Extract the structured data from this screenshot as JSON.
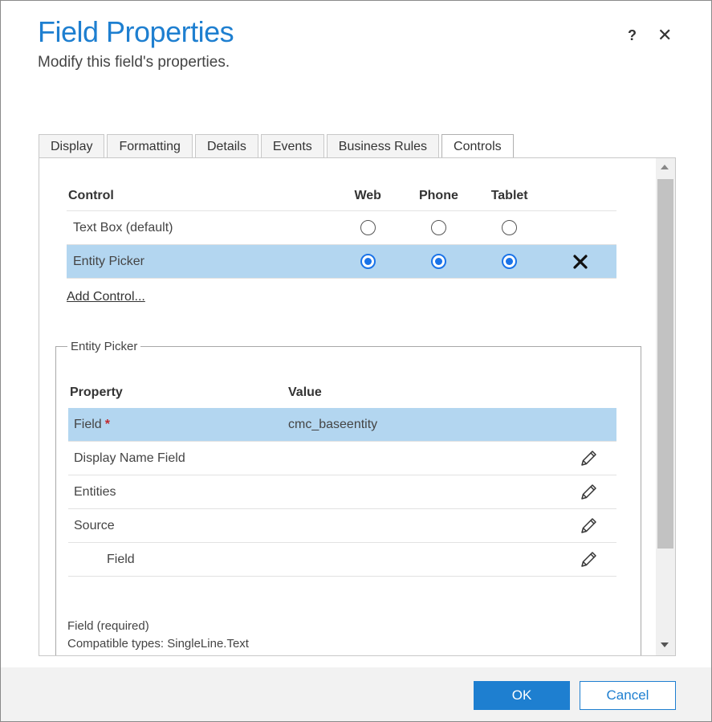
{
  "header": {
    "title": "Field Properties",
    "subtitle": "Modify this field's properties.",
    "help_label": "?",
    "close_label": "✕"
  },
  "tabs": [
    {
      "label": "Display",
      "active": false
    },
    {
      "label": "Formatting",
      "active": false
    },
    {
      "label": "Details",
      "active": false
    },
    {
      "label": "Events",
      "active": false
    },
    {
      "label": "Business Rules",
      "active": false
    },
    {
      "label": "Controls",
      "active": true
    }
  ],
  "controls_table": {
    "headers": {
      "control": "Control",
      "web": "Web",
      "phone": "Phone",
      "tablet": "Tablet"
    },
    "rows": [
      {
        "name": "Text Box (default)",
        "web": false,
        "phone": false,
        "tablet": false,
        "selected": false,
        "deletable": false
      },
      {
        "name": "Entity Picker",
        "web": true,
        "phone": true,
        "tablet": true,
        "selected": true,
        "deletable": true
      }
    ],
    "delete_icon": "close-icon",
    "add_control_label": "Add Control..."
  },
  "entity_picker": {
    "legend": "Entity Picker",
    "headers": {
      "property": "Property",
      "value": "Value"
    },
    "rows": [
      {
        "name": "Field",
        "value": "cmc_baseentity",
        "required": true,
        "selected": true,
        "editable": false,
        "indent": false
      },
      {
        "name": "Display Name Field",
        "value": "",
        "required": false,
        "selected": false,
        "editable": true,
        "indent": false
      },
      {
        "name": "Entities",
        "value": "",
        "required": false,
        "selected": false,
        "editable": true,
        "indent": false
      },
      {
        "name": "Source",
        "value": "",
        "required": false,
        "selected": false,
        "editable": true,
        "indent": false
      },
      {
        "name": "Field",
        "value": "",
        "required": false,
        "selected": false,
        "editable": true,
        "indent": true
      }
    ],
    "required_marker": "*",
    "edit_icon": "pencil-icon",
    "description": {
      "line1": "Field (required)",
      "line2": "Compatible types: SingleLine.Text"
    }
  },
  "footer": {
    "ok_label": "OK",
    "cancel_label": "Cancel"
  },
  "colors": {
    "accent": "#1e7fd0",
    "selected_row": "#b3d6f0",
    "radio_on": "#1a73e8",
    "required": "#c0282d"
  }
}
